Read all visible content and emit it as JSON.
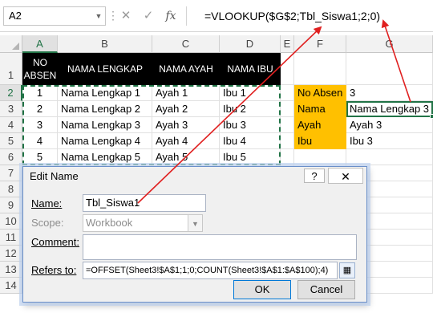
{
  "formula_bar": {
    "name_box": "A2",
    "formula": "=VLOOKUP($G$2;Tbl_Siswa1;2;0)",
    "cancel_glyph": "✕",
    "enter_glyph": "✓",
    "fx_glyph": "fx"
  },
  "columns": [
    "A",
    "B",
    "C",
    "D",
    "E",
    "F",
    "G"
  ],
  "rows": [
    "1",
    "2",
    "3",
    "4",
    "5",
    "6",
    "7",
    "8",
    "9",
    "10",
    "11",
    "12",
    "13",
    "14"
  ],
  "table": {
    "headers": [
      "NO ABSEN",
      "NAMA LENGKAP",
      "NAMA AYAH",
      "NAMA IBU"
    ],
    "header_no_line1": "NO",
    "header_no_line2": "ABSEN",
    "rows": [
      [
        "1",
        "Nama Lengkap 1",
        "Ayah 1",
        "Ibu 1"
      ],
      [
        "2",
        "Nama Lengkap 2",
        "Ayah 2",
        "Ibu 2"
      ],
      [
        "3",
        "Nama Lengkap 3",
        "Ayah 3",
        "Ibu 3"
      ],
      [
        "4",
        "Nama Lengkap 4",
        "Ayah 4",
        "Ibu 4"
      ],
      [
        "5",
        "Nama Lengkap 5",
        "Ayah 5",
        "Ibu 5"
      ]
    ]
  },
  "lookup": {
    "labels": [
      "No Absen",
      "Nama",
      "Ayah",
      "Ibu"
    ],
    "values": [
      "3",
      "Nama Lengkap 3",
      "Ayah 3",
      "Ibu 3"
    ]
  },
  "dialog": {
    "title": "Edit Name",
    "help": "?",
    "close": "✕",
    "name_label": "Name:",
    "name_value": "Tbl_Siswa1",
    "scope_label": "Scope:",
    "scope_value": "Workbook",
    "comment_label": "Comment:",
    "comment_value": "",
    "refers_label": "Refers to:",
    "refers_value": "=OFFSET(Sheet3!$A$1;1;0;COUNT(Sheet3!$A$1:$A$100);4)",
    "ok": "OK",
    "cancel": "Cancel"
  },
  "colors": {
    "accent_green": "#217346",
    "table_header_bg": "#000000",
    "label_orange": "#ffc000",
    "arrow_red": "#e02020",
    "dialog_border": "#6a8fc9"
  }
}
